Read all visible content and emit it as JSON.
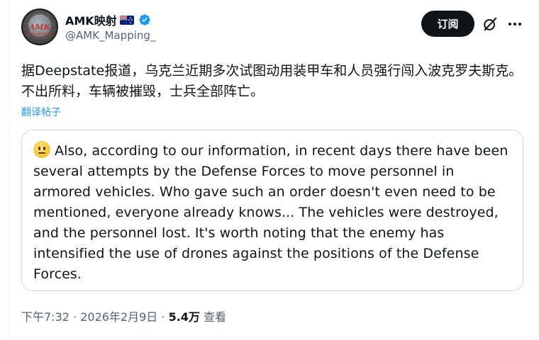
{
  "author": {
    "name": "AMK映射",
    "handle": "@AMK_Mapping_",
    "avatar_text": "AMK",
    "avatar_subtext": "Mapping",
    "flag_icon": "new-zealand-flag-icon",
    "verified_icon": "verified-badge-icon",
    "verified_color": "#1d9bf0"
  },
  "actions": {
    "subscribe_label": "订阅",
    "grok_icon": "grok-icon",
    "more_icon": "more-icon"
  },
  "post": {
    "text": "据Deepstate报道，乌克兰近期多次试图动用装甲车和人员强行闯入波克罗夫斯克。不出所料，车辆被摧毁，士兵全部阵亡。",
    "translate_label": "翻译帖子"
  },
  "quote": {
    "emoji_icon": "neutral-face-icon",
    "text": "Also, according to our information, in recent days there have been several attempts by the Defense Forces to move personnel in armored vehicles. Who gave such an order doesn't even need to be mentioned, everyone already knows... The vehicles were destroyed, and the personnel lost. It's worth noting that the enemy has intensified the use of drones against the positions of the Defense Forces."
  },
  "meta": {
    "time": "下午7:32",
    "separator": " · ",
    "date": "2026年2月9日",
    "views_count": "5.4万",
    "views_label": " 查看"
  }
}
